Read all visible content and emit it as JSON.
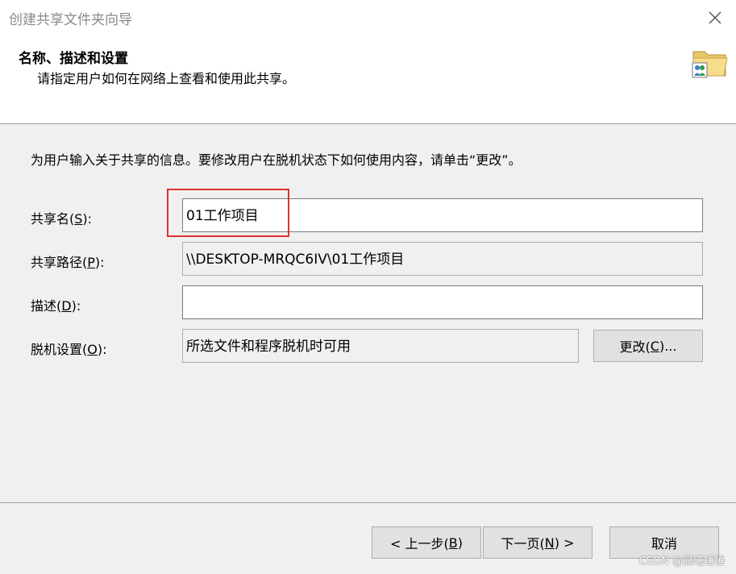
{
  "window": {
    "title": "创建共享文件夹向导"
  },
  "header": {
    "title": "名称、描述和设置",
    "subtitle": "请指定用户如何在网络上查看和使用此共享。",
    "icon": "shared-folder-icon"
  },
  "form": {
    "intro": "为用户输入关于共享的信息。要修改用户在脱机状态下如何使用内容，请单击“更改”。",
    "share_name": {
      "label_pre": "共享名(",
      "label_key": "S",
      "label_post": "):",
      "value": "01工作项目"
    },
    "share_path": {
      "label_pre": "共享路径(",
      "label_key": "P",
      "label_post": "):",
      "value": "\\\\DESKTOP-MRQC6IV\\01工作项目"
    },
    "description": {
      "label_pre": "描述(",
      "label_key": "D",
      "label_post": "):",
      "value": ""
    },
    "offline": {
      "label_pre": "脱机设置(",
      "label_key": "O",
      "label_post": "):",
      "value": "所选文件和程序脱机时可用",
      "change_pre": "更改(",
      "change_key": "C",
      "change_post": ")..."
    }
  },
  "footer": {
    "back_pre": "< 上一步(",
    "back_key": "B",
    "back_post": ")",
    "next_pre": "下一页(",
    "next_key": "N",
    "next_post": ") >",
    "cancel": "取消"
  },
  "watermark": "CSDN @晨曦锤锤",
  "colors": {
    "highlight_border": "#e03030",
    "header_bg": "#ffffff",
    "body_bg": "#f0f0f0"
  }
}
